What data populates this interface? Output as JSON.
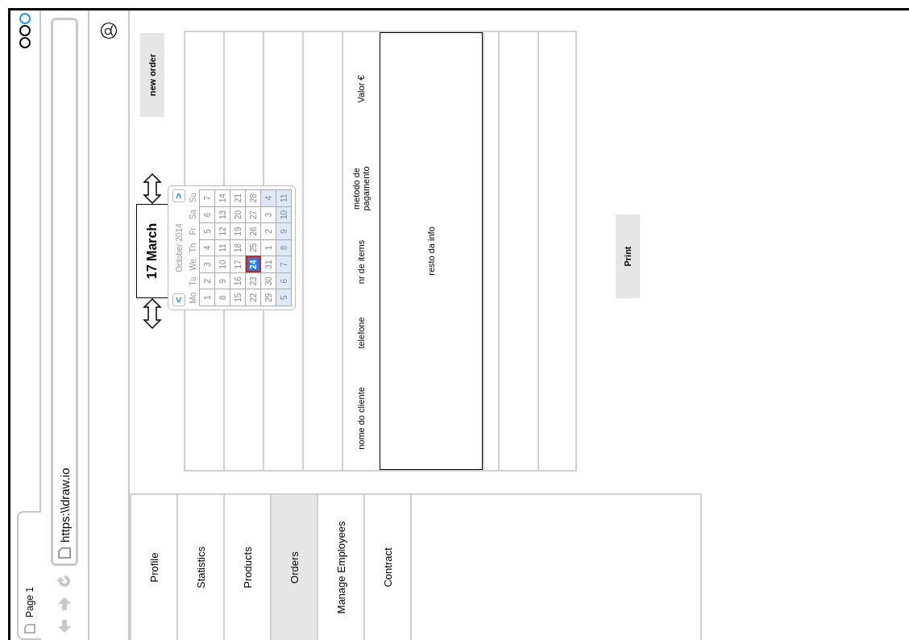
{
  "browser": {
    "tab": {
      "label": "Page 1",
      "selected": true
    },
    "address": "https:\\\\draw.io"
  },
  "nav": {
    "items": [
      {
        "label": "Profile",
        "selected": false
      },
      {
        "label": "Statistics",
        "selected": false
      },
      {
        "label": "Products",
        "selected": false
      },
      {
        "label": "Orders",
        "selected": true
      },
      {
        "label": "Manage Employees",
        "selected": false
      },
      {
        "label": "Contract",
        "selected": false
      }
    ]
  },
  "toolbar": {
    "date": "17 March",
    "new_order": "new order"
  },
  "calendar": {
    "title": "October 2014",
    "prev": "<",
    "next": ">",
    "weekdays": [
      "Mo",
      "Tu",
      "We",
      "Th",
      "Fr",
      "Sa",
      "Su"
    ],
    "weeks": [
      [
        {
          "day": "1",
          "shaded": false,
          "selected": false
        },
        {
          "day": "2",
          "shaded": false,
          "selected": false
        },
        {
          "day": "3",
          "shaded": false,
          "selected": false
        },
        {
          "day": "4",
          "shaded": false,
          "selected": false
        },
        {
          "day": "5",
          "shaded": false,
          "selected": false
        },
        {
          "day": "6",
          "shaded": false,
          "selected": false
        },
        {
          "day": "7",
          "shaded": false,
          "selected": false
        }
      ],
      [
        {
          "day": "8",
          "shaded": false,
          "selected": false
        },
        {
          "day": "9",
          "shaded": false,
          "selected": false
        },
        {
          "day": "10",
          "shaded": false,
          "selected": false
        },
        {
          "day": "11",
          "shaded": false,
          "selected": false
        },
        {
          "day": "12",
          "shaded": false,
          "selected": false
        },
        {
          "day": "13",
          "shaded": false,
          "selected": false
        },
        {
          "day": "14",
          "shaded": false,
          "selected": false
        }
      ],
      [
        {
          "day": "15",
          "shaded": false,
          "selected": false
        },
        {
          "day": "16",
          "shaded": false,
          "selected": false
        },
        {
          "day": "17",
          "shaded": false,
          "selected": false
        },
        {
          "day": "18",
          "shaded": false,
          "selected": false
        },
        {
          "day": "19",
          "shaded": false,
          "selected": false
        },
        {
          "day": "20",
          "shaded": false,
          "selected": false
        },
        {
          "day": "21",
          "shaded": false,
          "selected": false
        }
      ],
      [
        {
          "day": "22",
          "shaded": false,
          "selected": false
        },
        {
          "day": "23",
          "shaded": false,
          "selected": false
        },
        {
          "day": "24",
          "shaded": false,
          "selected": true
        },
        {
          "day": "25",
          "shaded": false,
          "selected": false
        },
        {
          "day": "26",
          "shaded": false,
          "selected": false
        },
        {
          "day": "27",
          "shaded": false,
          "selected": false
        },
        {
          "day": "28",
          "shaded": false,
          "selected": false
        }
      ],
      [
        {
          "day": "29",
          "shaded": false,
          "selected": false
        },
        {
          "day": "30",
          "shaded": false,
          "selected": false
        },
        {
          "day": "31",
          "shaded": false,
          "selected": false
        },
        {
          "day": "1",
          "shaded": false,
          "selected": false
        },
        {
          "day": "2",
          "shaded": false,
          "selected": false
        },
        {
          "day": "3",
          "shaded": false,
          "selected": false
        },
        {
          "day": "4",
          "shaded": true,
          "selected": false
        }
      ],
      [
        {
          "day": "5",
          "shaded": true,
          "selected": false
        },
        {
          "day": "6",
          "shaded": true,
          "selected": false
        },
        {
          "day": "7",
          "shaded": true,
          "selected": false
        },
        {
          "day": "8",
          "shaded": true,
          "selected": false
        },
        {
          "day": "9",
          "shaded": true,
          "selected": false
        },
        {
          "day": "10",
          "shaded": true,
          "selected": false
        },
        {
          "day": "11",
          "shaded": true,
          "selected": false
        }
      ]
    ]
  },
  "table": {
    "columns": [
      "nome do cliente",
      "telefone",
      "nr de items",
      "metodo de pagamento",
      "Valor €"
    ],
    "detail": "resto da info"
  },
  "print_button": "Print"
}
